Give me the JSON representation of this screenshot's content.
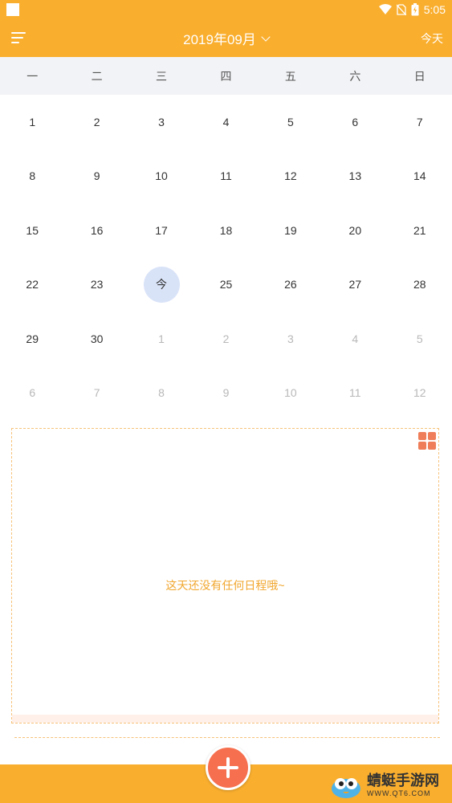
{
  "status_bar": {
    "time": "5:05"
  },
  "header": {
    "month_title": "2019年09月",
    "today_label": "今天"
  },
  "weekdays": [
    "一",
    "二",
    "三",
    "四",
    "五",
    "六",
    "日"
  ],
  "calendar": {
    "today_label": "今",
    "weeks": [
      [
        "1",
        "2",
        "3",
        "4",
        "5",
        "6",
        "7"
      ],
      [
        "8",
        "9",
        "10",
        "11",
        "12",
        "13",
        "14"
      ],
      [
        "15",
        "16",
        "17",
        "18",
        "19",
        "20",
        "21"
      ],
      [
        "22",
        "23",
        "今",
        "25",
        "26",
        "27",
        "28"
      ],
      [
        "29",
        "30",
        "1",
        "2",
        "3",
        "4",
        "5"
      ],
      [
        "6",
        "7",
        "8",
        "9",
        "10",
        "11",
        "12"
      ]
    ]
  },
  "schedule": {
    "empty_message": "这天还没有任何日程哦~"
  },
  "watermark": {
    "name": "蜻蜓手游网",
    "url": "WWW.QT6.COM"
  },
  "colors": {
    "accent": "#f9ae2e",
    "fab": "#f66f4e",
    "today_circle": "#d9e3f8",
    "empty_text": "#f1a72f"
  }
}
